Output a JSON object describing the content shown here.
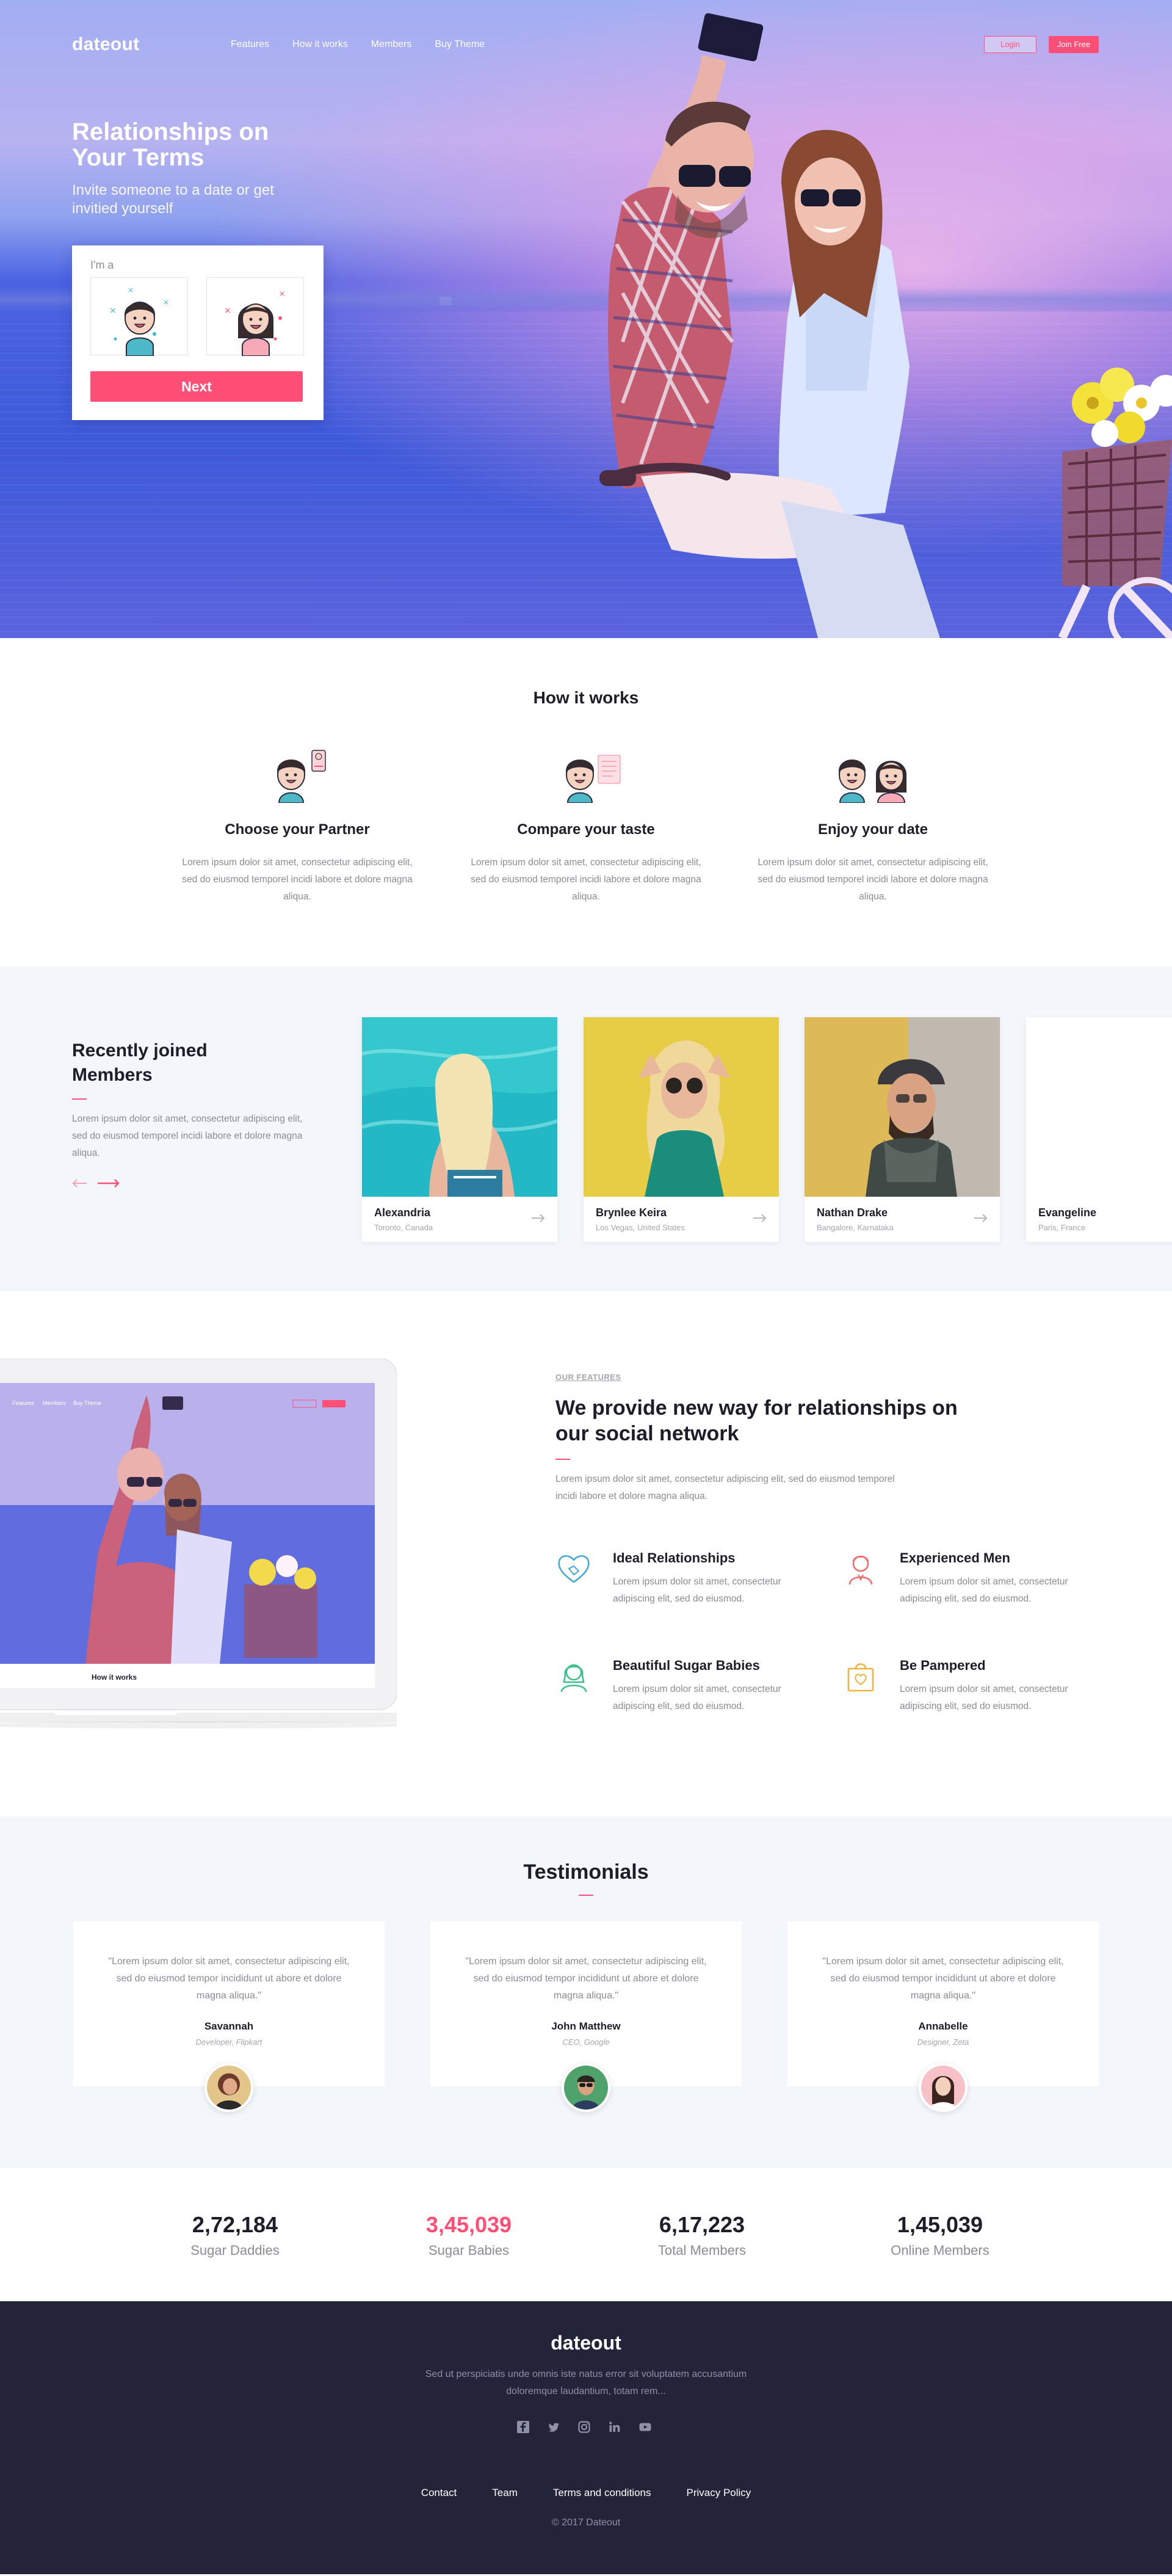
{
  "nav": {
    "brand": "dateout",
    "links": [
      "Features",
      "How it works",
      "Members",
      "Buy Theme"
    ],
    "login": "Login",
    "join": "Join Free"
  },
  "hero": {
    "title": "Relationships on Your Terms",
    "subtitle": "Invite someone to a date or get invitied yourself",
    "card_label": "I'm a",
    "next_button": "Next"
  },
  "how": {
    "title": "How it works",
    "steps": [
      {
        "title": "Choose your Partner",
        "text": "Lorem ipsum dolor sit amet, consectetur adipiscing elit, sed do eiusmod temporel incidi labore et dolore magna aliqua."
      },
      {
        "title": "Compare your taste",
        "text": "Lorem ipsum dolor sit amet, consectetur adipiscing elit, sed do eiusmod temporel incidi labore et dolore magna aliqua."
      },
      {
        "title": "Enjoy your date",
        "text": "Lorem ipsum dolor sit amet, consectetur adipiscing elit, sed do eiusmod temporel incidi labore et dolore magna aliqua."
      }
    ]
  },
  "members": {
    "title": "Recently joined Members",
    "text": "Lorem ipsum dolor sit amet, consectetur adipiscing elit, sed do eiusmod temporel incidi labore et dolore magna aliqua.",
    "cards": [
      {
        "name": "Alexandria",
        "location": "Toronto, Canada"
      },
      {
        "name": "Brynlee Keira",
        "location": "Los Vegas, United States"
      },
      {
        "name": "Nathan Drake",
        "location": "Bangalore, Karnataka"
      },
      {
        "name": "Evangeline",
        "location": "Paris, France"
      }
    ]
  },
  "features": {
    "eyebrow": "OUR FEATURES",
    "title": "We provide new way for relationships on our social network",
    "text": "Lorem ipsum dolor sit amet, consectetur adipiscing elit, sed do eiusmod temporel incidi labore et dolore magna aliqua.",
    "items": [
      {
        "title": "Ideal Relationships",
        "text": "Lorem ipsum dolor sit amet, consectetur adipiscing elit, sed do eiusmod."
      },
      {
        "title": "Experienced Men",
        "text": "Lorem ipsum dolor sit amet, consectetur adipiscing elit, sed do eiusmod."
      },
      {
        "title": "Beautiful Sugar Babies",
        "text": "Lorem ipsum dolor sit amet, consectetur adipiscing elit, sed do eiusmod."
      },
      {
        "title": "Be Pampered",
        "text": "Lorem ipsum dolor sit amet, consectetur adipiscing elit, sed do eiusmod."
      }
    ],
    "laptop_nav": [
      "Features",
      "Members",
      "Buy Theme"
    ],
    "laptop_section": "How it works"
  },
  "testimonials": {
    "title": "Testimonials",
    "items": [
      {
        "quote": "\"Lorem ipsum dolor sit amet, consectetur adipiscing elit, sed do eiusmod tempor incididunt ut abore et dolore magna aliqua.\"",
        "name": "Savannah",
        "role": "Developer, Flipkart"
      },
      {
        "quote": "\"Lorem ipsum dolor sit amet, consectetur adipiscing elit, sed do eiusmod tempor incididunt ut abore et dolore magna aliqua.\"",
        "name": "John Matthew",
        "role": "CEO, Google"
      },
      {
        "quote": "\"Lorem ipsum dolor sit amet, consectetur adipiscing elit, sed do eiusmod tempor incididunt ut abore et dolore magna aliqua.\"",
        "name": "Annabelle",
        "role": "Designer, Zeta"
      }
    ]
  },
  "stats": [
    {
      "value": "2,72,184",
      "label": "Sugar Daddies"
    },
    {
      "value": "3,45,039",
      "label": "Sugar Babies"
    },
    {
      "value": "6,17,223",
      "label": "Total Members"
    },
    {
      "value": "1,45,039",
      "label": "Online Members"
    }
  ],
  "footer": {
    "brand": "dateout",
    "text": "Sed ut perspiciatis unde omnis iste natus error sit voluptatem accusantium doloremque laudantium, totam rem...",
    "social_icons": [
      "facebook-icon",
      "twitter-icon",
      "instagram-icon",
      "linkedin-icon",
      "youtube-icon"
    ],
    "links": [
      "Contact",
      "Team",
      "Terms and conditions",
      "Privacy Policy"
    ],
    "copyright": "© 2017 Dateout"
  },
  "colors": {
    "accent": "#ff4f77",
    "dark": "#23243a",
    "text": "#1e1e2a",
    "muted": "#8b8b97",
    "light_bg": "#f3f6fa"
  }
}
